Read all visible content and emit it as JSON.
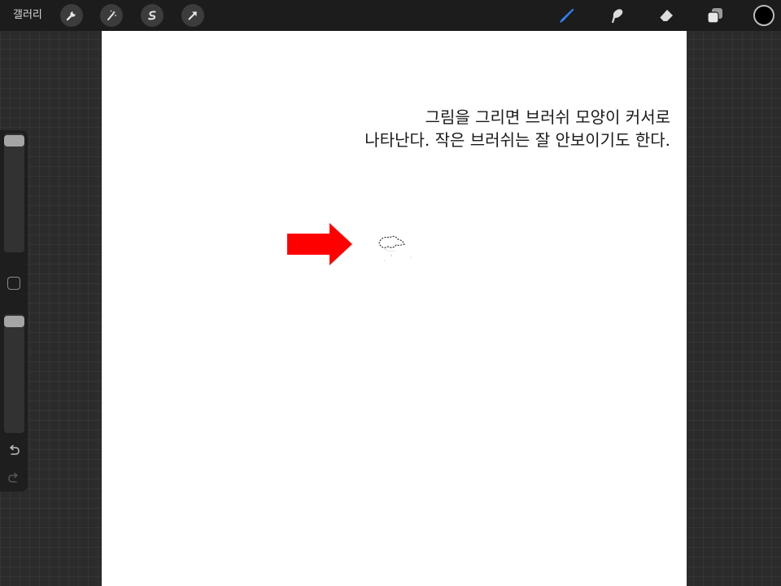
{
  "toolbar": {
    "gallery_label": "갤러리",
    "left_tools": [
      {
        "name": "wrench-icon"
      },
      {
        "name": "magic-wand-icon"
      },
      {
        "name": "selection-icon"
      },
      {
        "name": "transform-arrow-icon"
      }
    ],
    "right_tools": [
      {
        "name": "brush-icon",
        "active": true,
        "color": "#2f7ff0"
      },
      {
        "name": "smudge-icon"
      },
      {
        "name": "eraser-icon"
      },
      {
        "name": "layers-icon"
      }
    ],
    "current_color": "#000000"
  },
  "canvas": {
    "note_lines": [
      "그림을 그리면 브러쉬 모양이 커서로",
      "나타난다. 작은 브러쉬는 잘 안보이기도 한다."
    ],
    "arrow_color": "#ff0000"
  },
  "sidebar": {
    "brush_size_level": 1.0,
    "opacity_level": 1.0
  }
}
